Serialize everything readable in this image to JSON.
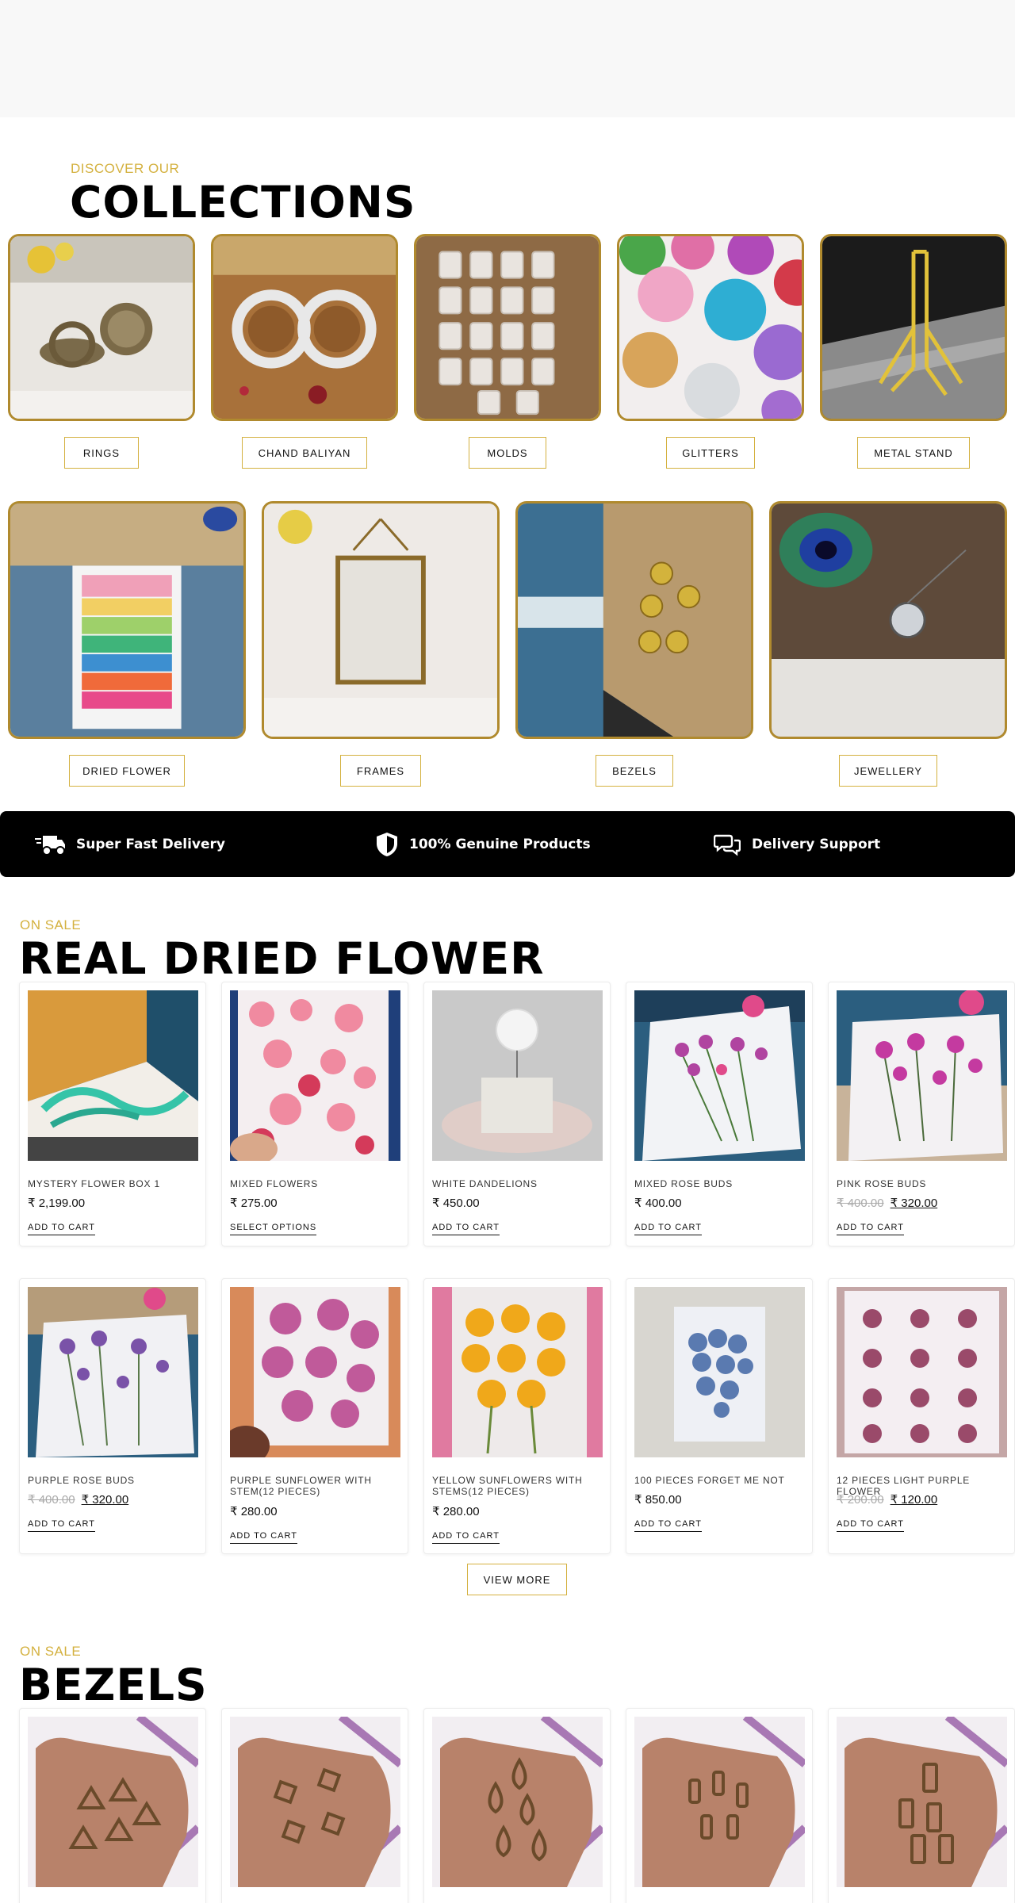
{
  "collections_section": {
    "eyebrow": "DISCOVER OUR",
    "title": "COLLECTIONS",
    "items": [
      {
        "label": "RINGS"
      },
      {
        "label": "CHAND BALIYAN"
      },
      {
        "label": "MOLDS"
      },
      {
        "label": "GLITTERS"
      },
      {
        "label": "METAL STAND"
      },
      {
        "label": "DRIED FLOWER"
      },
      {
        "label": "FRAMES"
      },
      {
        "label": "BEZELS"
      },
      {
        "label": "JEWELLERY"
      }
    ]
  },
  "features": [
    {
      "icon": "delivery-truck-icon",
      "label": "Super Fast Delivery"
    },
    {
      "icon": "shield-icon",
      "label": "100% Genuine Products"
    },
    {
      "icon": "chat-bubbles-icon",
      "label": "Delivery Support"
    }
  ],
  "dried_flower_section": {
    "eyebrow": "ON SALE",
    "title": "REAL DRIED FLOWER",
    "products": [
      {
        "name": "MYSTERY FLOWER BOX 1",
        "old_price": "",
        "price": "₹ 2,199.00",
        "button": "ADD TO CART"
      },
      {
        "name": "MIXED FLOWERS",
        "old_price": "",
        "price": "₹ 275.00",
        "button": "SELECT OPTIONS"
      },
      {
        "name": "WHITE DANDELIONS",
        "old_price": "",
        "price": "₹ 450.00",
        "button": "ADD TO CART"
      },
      {
        "name": "MIXED ROSE BUDS",
        "old_price": "",
        "price": "₹ 400.00",
        "button": "ADD TO CART"
      },
      {
        "name": "PINK ROSE BUDS",
        "old_price": "₹ 400.00",
        "price": "₹ 320.00",
        "button": "ADD TO CART"
      },
      {
        "name": "PURPLE ROSE BUDS",
        "old_price": "₹ 400.00",
        "price": "₹ 320.00",
        "button": "ADD TO CART"
      },
      {
        "name": "PURPLE SUNFLOWER WITH STEM(12 PIECES)",
        "old_price": "",
        "price": "₹ 280.00",
        "button": "ADD TO CART"
      },
      {
        "name": "YELLOW SUNFLOWERS WITH STEMS(12 PIECES)",
        "old_price": "",
        "price": "₹ 280.00",
        "button": "ADD TO CART"
      },
      {
        "name": "100 PIECES FORGET ME NOT",
        "old_price": "",
        "price": "₹ 850.00",
        "button": "ADD TO CART"
      },
      {
        "name": "12 PIECES LIGHT PURPLE FLOWER",
        "old_price": "₹ 200.00",
        "price": "₹ 120.00",
        "button": "ADD TO CART"
      }
    ],
    "view_more": "VIEW MORE"
  },
  "bezels_section": {
    "eyebrow": "ON SALE",
    "title": "BEZELS"
  },
  "colors": {
    "accent_gold": "#d4b13f",
    "frame_gold": "#b08a2e",
    "bar_black": "#000000"
  }
}
